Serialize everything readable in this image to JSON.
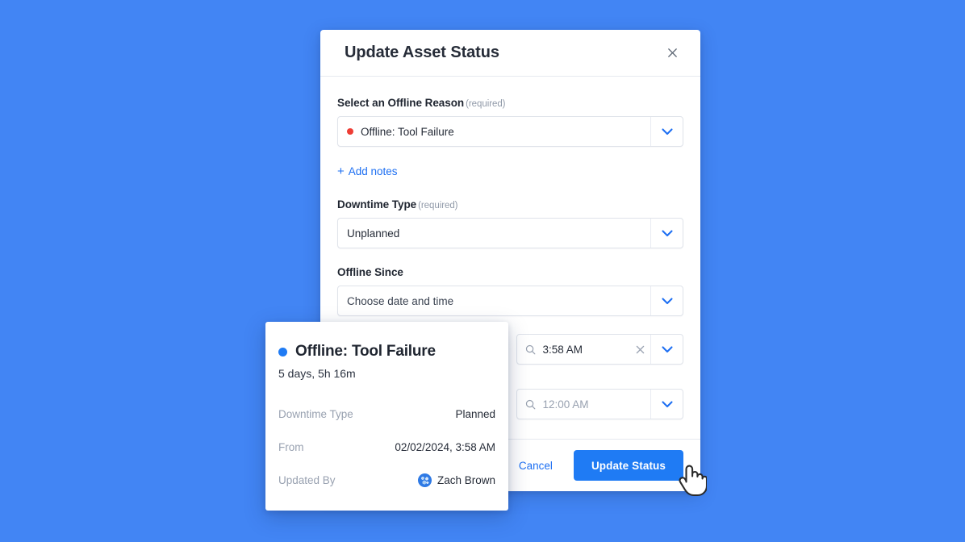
{
  "background_color": "#4285f4",
  "modal": {
    "title": "Update Asset Status",
    "close_icon": "close-icon",
    "fields": {
      "offline_reason": {
        "label": "Select an Offline Reason",
        "required_text": "(required)",
        "value": "Offline: Tool Failure",
        "status_dot_color": "#ee3d35",
        "chevron_icon": "chevron-down-icon"
      },
      "add_notes": {
        "label": "Add notes",
        "plus_icon": "plus-icon",
        "color": "#1d6ff2"
      },
      "downtime_type": {
        "label": "Downtime Type",
        "required_text": "(required)",
        "value": "Unplanned",
        "chevron_icon": "chevron-down-icon"
      },
      "offline_since": {
        "label": "Offline Since",
        "value": "Choose date and time",
        "chevron_icon": "chevron-down-icon"
      },
      "time_start": {
        "search_icon": "search-icon",
        "value": "3:58 AM",
        "clear_icon": "clear-x-icon",
        "chevron_icon": "chevron-down-icon"
      },
      "time_end": {
        "search_icon": "search-icon",
        "placeholder": "12:00 AM",
        "chevron_icon": "chevron-down-icon"
      }
    },
    "footer": {
      "cancel_label": "Cancel",
      "submit_label": "Update Status",
      "submit_color": "#1f7bf4"
    }
  },
  "popover": {
    "status_dot_color": "#1f7bf4",
    "title": "Offline: Tool Failure",
    "duration": "5 days, 5h 16m",
    "rows": [
      {
        "key": "Downtime Type",
        "value": "Planned"
      },
      {
        "key": "From",
        "value": "02/02/2024, 3:58 AM"
      },
      {
        "key": "Updated By",
        "value": "Zach Brown",
        "avatar": "user-avatar"
      }
    ]
  },
  "cursor": {
    "icon": "pointer-hand-cursor"
  }
}
